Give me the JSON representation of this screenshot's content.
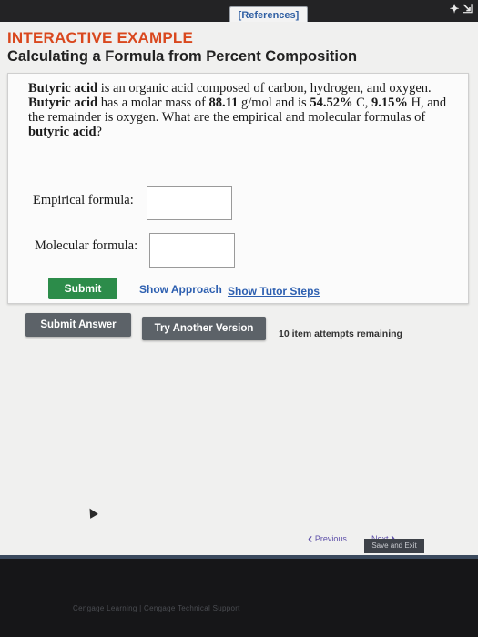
{
  "header": {
    "references_label": "[References]",
    "icons": "✦ ⇲"
  },
  "example": {
    "label": "INTERACTIVE EXAMPLE",
    "title": "Calculating a Formula from Percent Composition"
  },
  "question": {
    "line1_pre": "Butyric acid",
    "line1_post": " is an organic acid composed of carbon, hydrogen, and oxygen.",
    "line2_pre": "Butyric acid",
    "line2_mid": " has a molar mass of ",
    "molar_mass": "88.11",
    "line2_unit": " g/mol and is ",
    "percent_c": "54.52%",
    "c_label": " C, ",
    "percent_h": "9.15%",
    "h_label": " H, and",
    "line3": "the remainder is oxygen. What are the empirical and molecular formulas of",
    "line4": "butyric acid",
    "line4_end": "?"
  },
  "form": {
    "empirical_label": "Empirical formula:",
    "empirical_value": "",
    "molecular_label": "Molecular formula:",
    "molecular_value": "",
    "submit_label": "Submit",
    "show_approach": "Show Approach",
    "show_tutor_steps": "Show Tutor Steps"
  },
  "actions": {
    "submit_answer": "Submit Answer",
    "try_another": "Try Another Version",
    "attempts": "10 item attempts remaining"
  },
  "nav": {
    "previous": "Previous",
    "next": "Next",
    "save_exit": "Save and Exit"
  },
  "footer": {
    "text": "Cengage Learning  |  Cengage Technical Support"
  },
  "colors": {
    "accent_orange": "#d9481e",
    "submit_green": "#2c8c4a",
    "link_blue": "#2d5fb0",
    "button_gray": "#5c6268"
  }
}
